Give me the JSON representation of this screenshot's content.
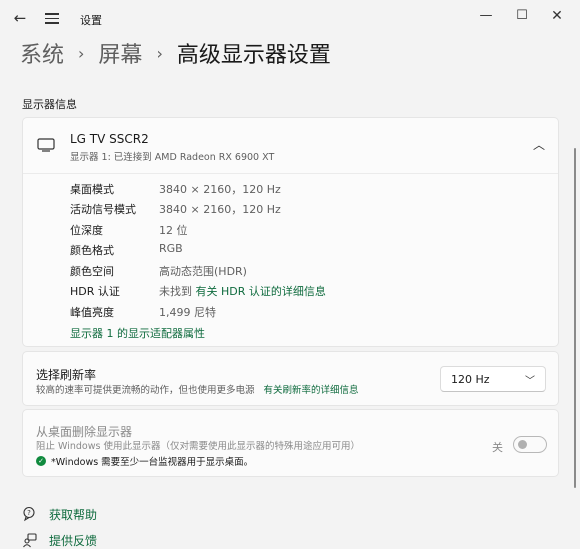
{
  "titlebar": {
    "title": "设置",
    "back_glyph": "←",
    "minimize_glyph": "—",
    "maximize_glyph": "☐",
    "close_glyph": "✕"
  },
  "breadcrumb": {
    "items": [
      "系统",
      "屏幕"
    ],
    "current": "高级显示器设置",
    "separator": "›"
  },
  "section_label": "显示器信息",
  "display": {
    "name": "LG TV SSCR2",
    "subtitle": "显示器 1: 已连接到 AMD Radeon RX 6900 XT",
    "icon": "monitor-icon",
    "rows": [
      {
        "label": "桌面模式",
        "value": "3840 × 2160，120 Hz"
      },
      {
        "label": "活动信号模式",
        "value": "3840 × 2160，120 Hz"
      },
      {
        "label": "位深度",
        "value": "12 位"
      },
      {
        "label": "颜色格式",
        "value": "RGB"
      },
      {
        "label": "颜色空间",
        "value": "高动态范围(HDR)"
      },
      {
        "label": "HDR 认证",
        "value_prefix": "未找到 ",
        "value_link": "有关 HDR 认证的详细信息"
      },
      {
        "label": "峰值亮度",
        "value": "1,499 尼特"
      }
    ],
    "adapter_link": "显示器 1 的显示适配器属性"
  },
  "refresh": {
    "title": "选择刷新率",
    "description": "较高的速率可提供更流畅的动作，但也使用更多电源",
    "link": "有关刷新率的详细信息",
    "selected": "120 Hz"
  },
  "remove_display": {
    "title": "从桌面删除显示器",
    "description": "阻止 Windows 使用此显示器（仅对需要使用此显示器的特殊用途应用可用）",
    "note": "*Windows 需要至少一台监视器用于显示桌面。",
    "toggle_label": "关",
    "toggle_on": false
  },
  "help": {
    "get_help": "获取帮助",
    "feedback": "提供反馈"
  },
  "colors": {
    "accent_link": "#0f6b3e",
    "background": "#f3f3f3",
    "card": "#fbfbfb"
  }
}
